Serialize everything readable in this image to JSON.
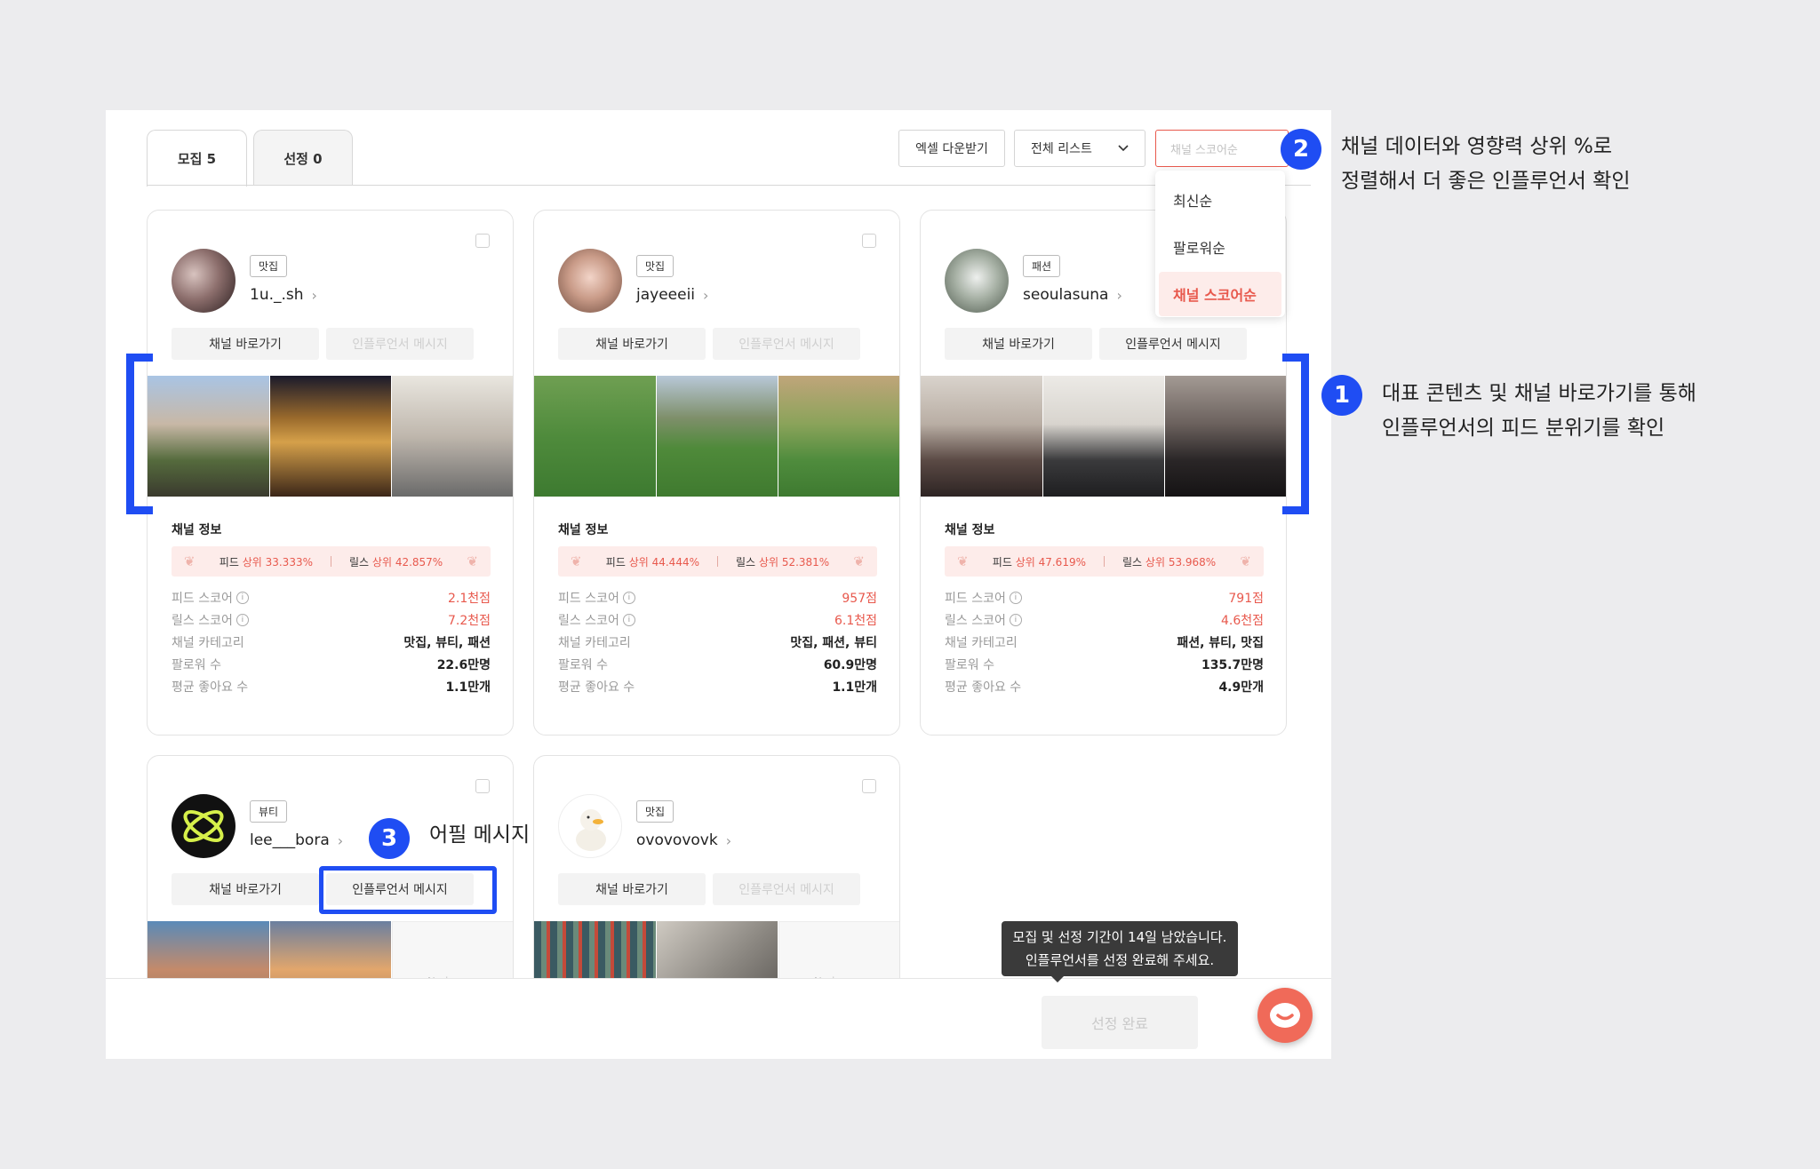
{
  "tabs": [
    {
      "label": "모집 5"
    },
    {
      "label": "선정 0"
    }
  ],
  "toolbar": {
    "excel_label": "엑셀 다운받기",
    "list_filter_label": "전체 리스트",
    "sort_placeholder": "채널 스코어순"
  },
  "sort_menu": {
    "options": [
      "최신순",
      "팔로워순",
      "채널 스코어순"
    ],
    "selected": "채널 스코어순"
  },
  "labels": {
    "channel_go": "채널 바로가기",
    "influencer_msg": "인플루언서 메시지",
    "channel_info": "채널 정보",
    "feed_score": "피드 스코어",
    "reels_score": "릴스 스코어",
    "category": "채널 카테고리",
    "followers": "팔로워 수",
    "avg_likes": "평균 좋아요 수",
    "no_image": "No image",
    "feed_rank_prefix": "피드",
    "reels_rank_prefix": "릴스"
  },
  "cards": [
    {
      "tag": "맛집",
      "handle": "1u._.sh",
      "msg_enabled": false,
      "feed_rank": "상위 33.333%",
      "reels_rank": "상위 42.857%",
      "feed_score": "2.1천점",
      "reels_score": "7.2천점",
      "category": "맛집, 뷰티, 패션",
      "followers": "22.6만명",
      "avg_likes": "1.1만개"
    },
    {
      "tag": "맛집",
      "handle": "jayeeeii",
      "msg_enabled": false,
      "feed_rank": "상위 44.444%",
      "reels_rank": "상위 52.381%",
      "feed_score": "957점",
      "reels_score": "6.1천점",
      "category": "맛집, 패션, 뷰티",
      "followers": "60.9만명",
      "avg_likes": "1.1만개"
    },
    {
      "tag": "패션",
      "handle": "seoulasuna",
      "msg_enabled": true,
      "feed_rank": "상위 47.619%",
      "reels_rank": "상위 53.968%",
      "feed_score": "791점",
      "reels_score": "4.6천점",
      "category": "패션, 뷰티, 맛집",
      "followers": "135.7만명",
      "avg_likes": "4.9만개"
    },
    {
      "tag": "뷰티",
      "handle": "lee___bora",
      "msg_enabled": true
    },
    {
      "tag": "맛집",
      "handle": "ovovovovk",
      "msg_enabled": false
    }
  ],
  "tooltip": {
    "line1": "모집 및 선정 기간이 14일 남았습니다.",
    "line2": "인플루언서를 선정 완료해 주세요."
  },
  "done_button": "선정 완료",
  "annotations": {
    "a1": {
      "num": "1",
      "line1": "대표 콘텐츠 및 채널 바로가기를 통해",
      "line2": "인플루언서의 피드 분위기를 확인"
    },
    "a2": {
      "num": "2",
      "line1": "채널 데이터와 영향력 상위 %로",
      "line2": "정렬해서 더 좋은 인플루언서 확인"
    },
    "a3": {
      "num": "3",
      "line1": "어필 메시지"
    }
  },
  "colors": {
    "accent_red": "#e8594d",
    "annotation_blue": "#1f4df3"
  }
}
